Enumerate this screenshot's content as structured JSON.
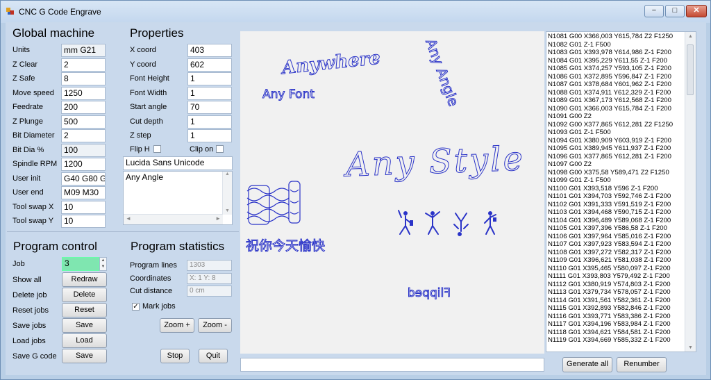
{
  "window": {
    "title": "CNC G Code Engrave",
    "min": "−",
    "max": "□",
    "close": "✕"
  },
  "global_machine": {
    "heading": "Global machine",
    "fields": [
      {
        "label": "Units",
        "value": "mm G21",
        "readonly": true
      },
      {
        "label": "Z Clear",
        "value": "2"
      },
      {
        "label": "Z Safe",
        "value": "8"
      },
      {
        "label": "Move speed",
        "value": "1250"
      },
      {
        "label": "Feedrate",
        "value": "200"
      },
      {
        "label": "Z Plunge",
        "value": "500"
      },
      {
        "label": "Bit Diameter",
        "value": "2"
      },
      {
        "label": "Bit Dia %",
        "value": "100",
        "readonly": true
      },
      {
        "label": "Spindle RPM",
        "value": "1200"
      },
      {
        "label": "User init",
        "value": "G40 G80 G"
      },
      {
        "label": "User end",
        "value": "M09 M30"
      },
      {
        "label": "Tool swap X",
        "value": "10"
      },
      {
        "label": "Tool swap Y",
        "value": "10"
      }
    ]
  },
  "properties": {
    "heading": "Properties",
    "fields": [
      {
        "label": "X coord",
        "value": "403"
      },
      {
        "label": "Y coord",
        "value": "602"
      },
      {
        "label": "Font Height",
        "value": "1"
      },
      {
        "label": "Font Width",
        "value": "1"
      },
      {
        "label": "Start angle",
        "value": "70"
      },
      {
        "label": "Cut depth",
        "value": "1"
      },
      {
        "label": "Z step",
        "value": "1"
      }
    ],
    "flip_h": "Flip H",
    "clip_on": "Clip on",
    "font_name": "Lucida Sans Unicode",
    "text": "Any Angle"
  },
  "program_control": {
    "heading": "Program control",
    "job_label": "Job",
    "job_value": "3",
    "rows": [
      {
        "label": "Show all",
        "button": "Redraw"
      },
      {
        "label": "Delete job",
        "button": "Delete"
      },
      {
        "label": "Reset jobs",
        "button": "Reset"
      },
      {
        "label": "Save jobs",
        "button": "Save"
      },
      {
        "label": "Load jobs",
        "button": "Load"
      },
      {
        "label": "Save G code",
        "button": "Save"
      }
    ]
  },
  "program_statistics": {
    "heading": "Program statistics",
    "fields": [
      {
        "label": "Program lines",
        "value": "1303"
      },
      {
        "label": "Coordinates",
        "value": "X: 1  Y: 8"
      },
      {
        "label": "Cut distance",
        "value": "0 cm"
      }
    ],
    "mark_jobs": "Mark jobs",
    "mark_jobs_checked": true,
    "zoom_in": "Zoom +",
    "zoom_out": "Zoom -",
    "stop": "Stop",
    "quit": "Quit"
  },
  "canvas": {
    "anywhere": "Anywhere",
    "any_font": "Any Font",
    "any_angle": "Any Angle",
    "any_style": "Any Style",
    "chinese": "祝你今天愉快",
    "flipped": "Flipped",
    "stroke_color": "#2a33c8"
  },
  "gcode_lines": [
    "N1081 G00 X366,003 Y615,784 Z2 F1250",
    "N1082 G01 Z-1 F500",
    "N1083 G01 X393,978 Y614,986 Z-1 F200",
    "N1084 G01 X395,229 Y611,55 Z-1 F200",
    "N1085 G01 X374,257 Y593,105 Z-1 F200",
    "N1086 G01 X372,895 Y596,847 Z-1 F200",
    "N1087 G01 X378,684 Y601,962 Z-1 F200",
    "N1088 G01 X374,911 Y612,329 Z-1 F200",
    "N1089 G01 X367,173 Y612,568 Z-1 F200",
    "N1090 G01 X366,003 Y615,784 Z-1 F200",
    "N1091 G00 Z2",
    "N1092 G00 X377,865 Y612,281 Z2 F1250",
    "N1093 G01 Z-1 F500",
    "N1094 G01 X380,909 Y603,919 Z-1 F200",
    "N1095 G01 X389,945 Y611,937 Z-1 F200",
    "N1096 G01 X377,865 Y612,281 Z-1 F200",
    "N1097 G00 Z2",
    "N1098 G00 X375,58 Y589,471 Z2 F1250",
    "N1099 G01 Z-1 F500",
    "N1100 G01 X393,518 Y596 Z-1 F200",
    "N1101 G01 X394,703 Y592,746 Z-1 F200",
    "N1102 G01 X391,333 Y591,519 Z-1 F200",
    "N1103 G01 X394,468 Y590,715 Z-1 F200",
    "N1104 G01 X396,489 Y589,068 Z-1 F200",
    "N1105 G01 X397,396 Y586,58 Z-1 F200",
    "N1106 G01 X397,964 Y585,016 Z-1 F200",
    "N1107 G01 X397,923 Y583,594 Z-1 F200",
    "N1108 G01 X397,272 Y582,317 Z-1 F200",
    "N1109 G01 X396,621 Y581,038 Z-1 F200",
    "N1110 G01 X395,465 Y580,097 Z-1 F200",
    "N1111 G01 X393,803 Y579,492 Z-1 F200",
    "N1112 G01 X380,919 Y574,803 Z-1 F200",
    "N1113 G01 X379,734 Y578,057 Z-1 F200",
    "N1114 G01 X391,561 Y582,361 Z-1 F200",
    "N1115 G01 X392,893 Y582,846 Z-1 F200",
    "N1116 G01 X393,771 Y583,386 Z-1 F200",
    "N1117 G01 X394,196 Y583,984 Z-1 F200",
    "N1118 G01 X394,621 Y584,581 Z-1 F200",
    "N1119 G01 X394,669 Y585,332 Z-1 F200"
  ],
  "bottom": {
    "command_value": "",
    "generate_all": "Generate all",
    "renumber": "Renumber"
  }
}
